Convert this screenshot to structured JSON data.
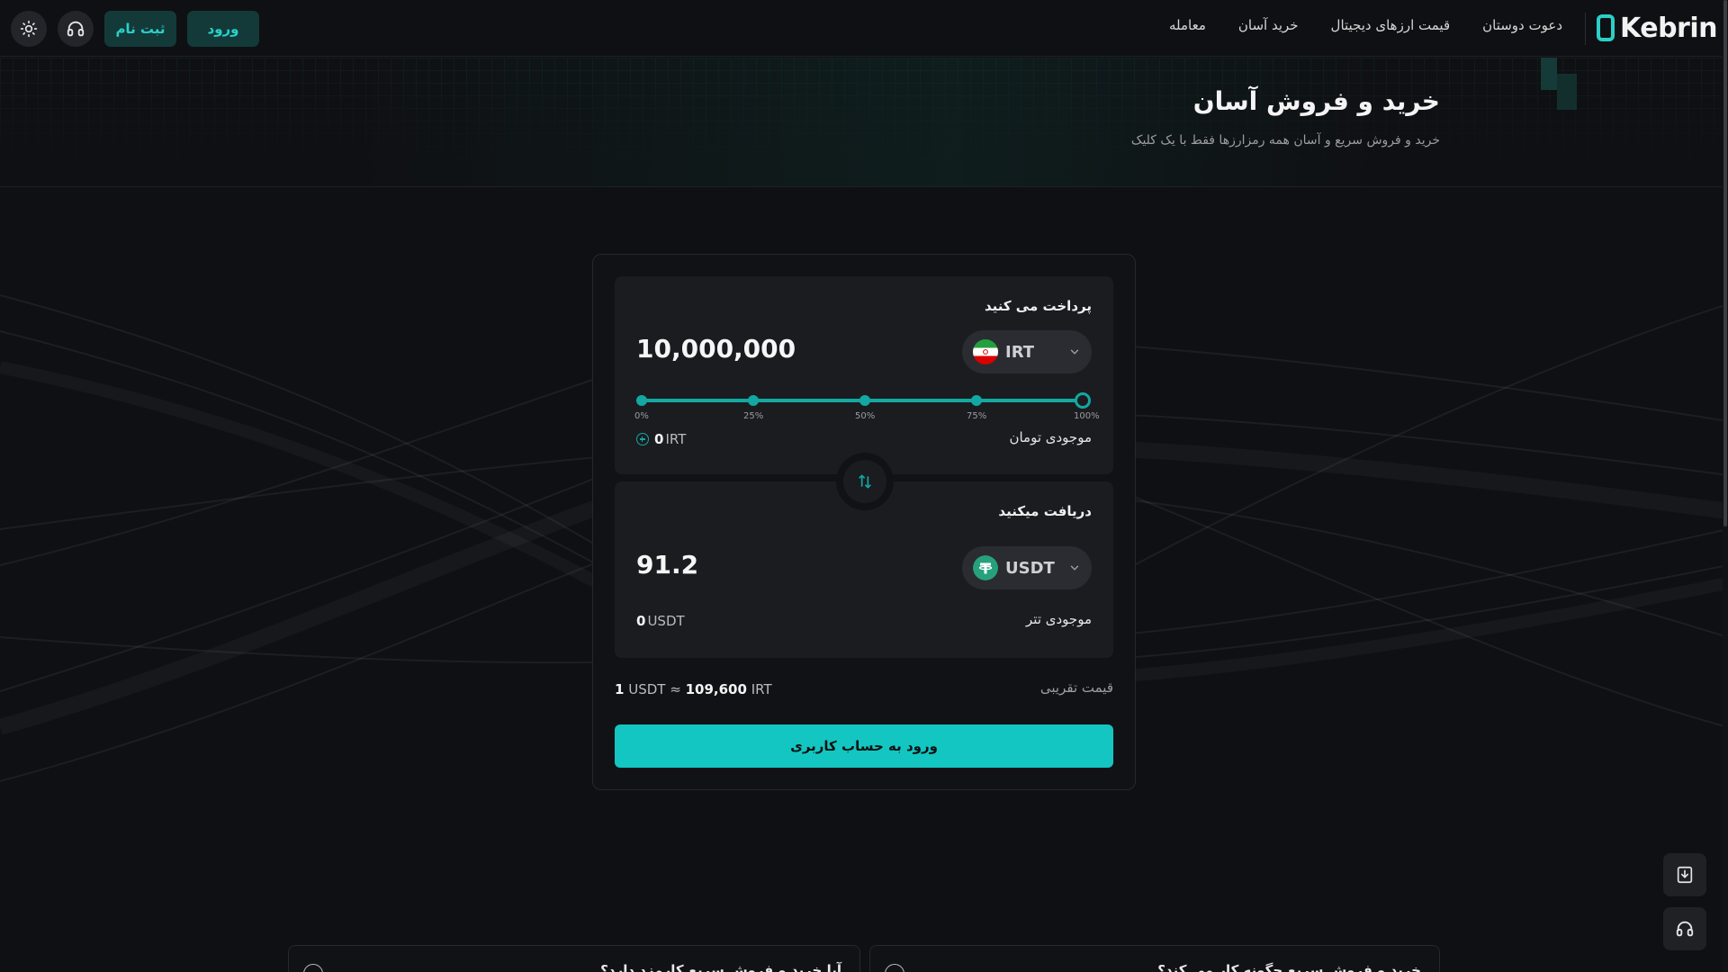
{
  "header": {
    "logo_text": "Kebrin",
    "nav": [
      {
        "label": "معامله"
      },
      {
        "label": "خرید آسان"
      },
      {
        "label": "قیمت ارزهای دیجیتال"
      },
      {
        "label": "دعوت دوستان"
      }
    ],
    "login_label": "ورود",
    "register_label": "ثبت نام"
  },
  "hero": {
    "title": "خرید و فروش آسان",
    "subtitle": "خرید و فروش سریع و آسان همه رمزارزها فقط با یک کلیک"
  },
  "pay": {
    "title": "پرداخت می کنید",
    "amount": "10,000,000",
    "coin": "IRT",
    "slider_value": 100,
    "slider_labels": [
      "0%",
      "25%",
      "50%",
      "75%",
      "100%"
    ],
    "balance_label": "موجودی تومان",
    "balance_amount": "0",
    "balance_unit": "IRT"
  },
  "receive": {
    "title": "دریافت میکنید",
    "amount": "91.2",
    "coin": "USDT",
    "balance_label": "موجودی تتر",
    "balance_amount": "0",
    "balance_unit": "USDT"
  },
  "rate": {
    "label": "قیمت تقریبی",
    "base_amount": "1",
    "base_unit": "USDT",
    "approx": "≈",
    "quote_amount": "109,600",
    "quote_unit": "IRT"
  },
  "cta_label": "ورود به حساب کاربری",
  "faq": [
    {
      "question": "خرید و فروش سریع چگونه کار می کند؟"
    },
    {
      "question": "آیا خرید و فروش سریع کارمزد دارد؟"
    }
  ],
  "icons": {
    "theme": "sun-icon",
    "support": "headset-icon",
    "swap": "swap-icon",
    "download": "download-icon",
    "chevron": "chevron-down-icon"
  },
  "colors": {
    "accent": "#14c6c1",
    "background": "#0f1013",
    "panel": "#1b1c20"
  }
}
